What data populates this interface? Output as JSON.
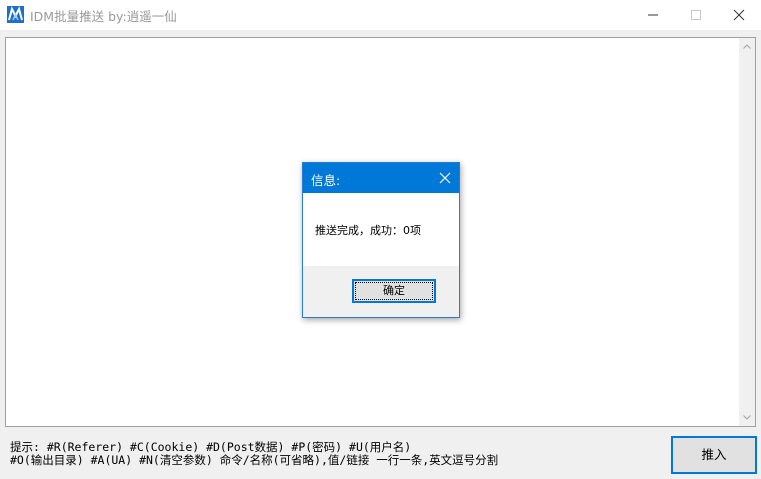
{
  "window": {
    "title": "IDM批量推送  by:逍遥一仙"
  },
  "hint": {
    "line1": "提示: #R(Referer) #C(Cookie) #D(Post数据) #P(密码) #U(用户名)",
    "line2": "#O(输出目录) #A(UA) #N(清空参数) 命令/名称(可省略),值/链接 一行一条,英文逗号分割"
  },
  "insert_button": {
    "label": "推入"
  },
  "dialog": {
    "title": "信息:",
    "message": "推送完成，成功：0项",
    "ok_label": "确定"
  },
  "colors": {
    "accent": "#0078d7",
    "title_text": "#999999"
  },
  "icons": {
    "app": "app-logo-icon",
    "minimize": "minimize-icon",
    "maximize": "maximize-icon",
    "close": "close-icon",
    "scroll_up": "chevron-up-icon",
    "scroll_down": "chevron-down-icon"
  }
}
